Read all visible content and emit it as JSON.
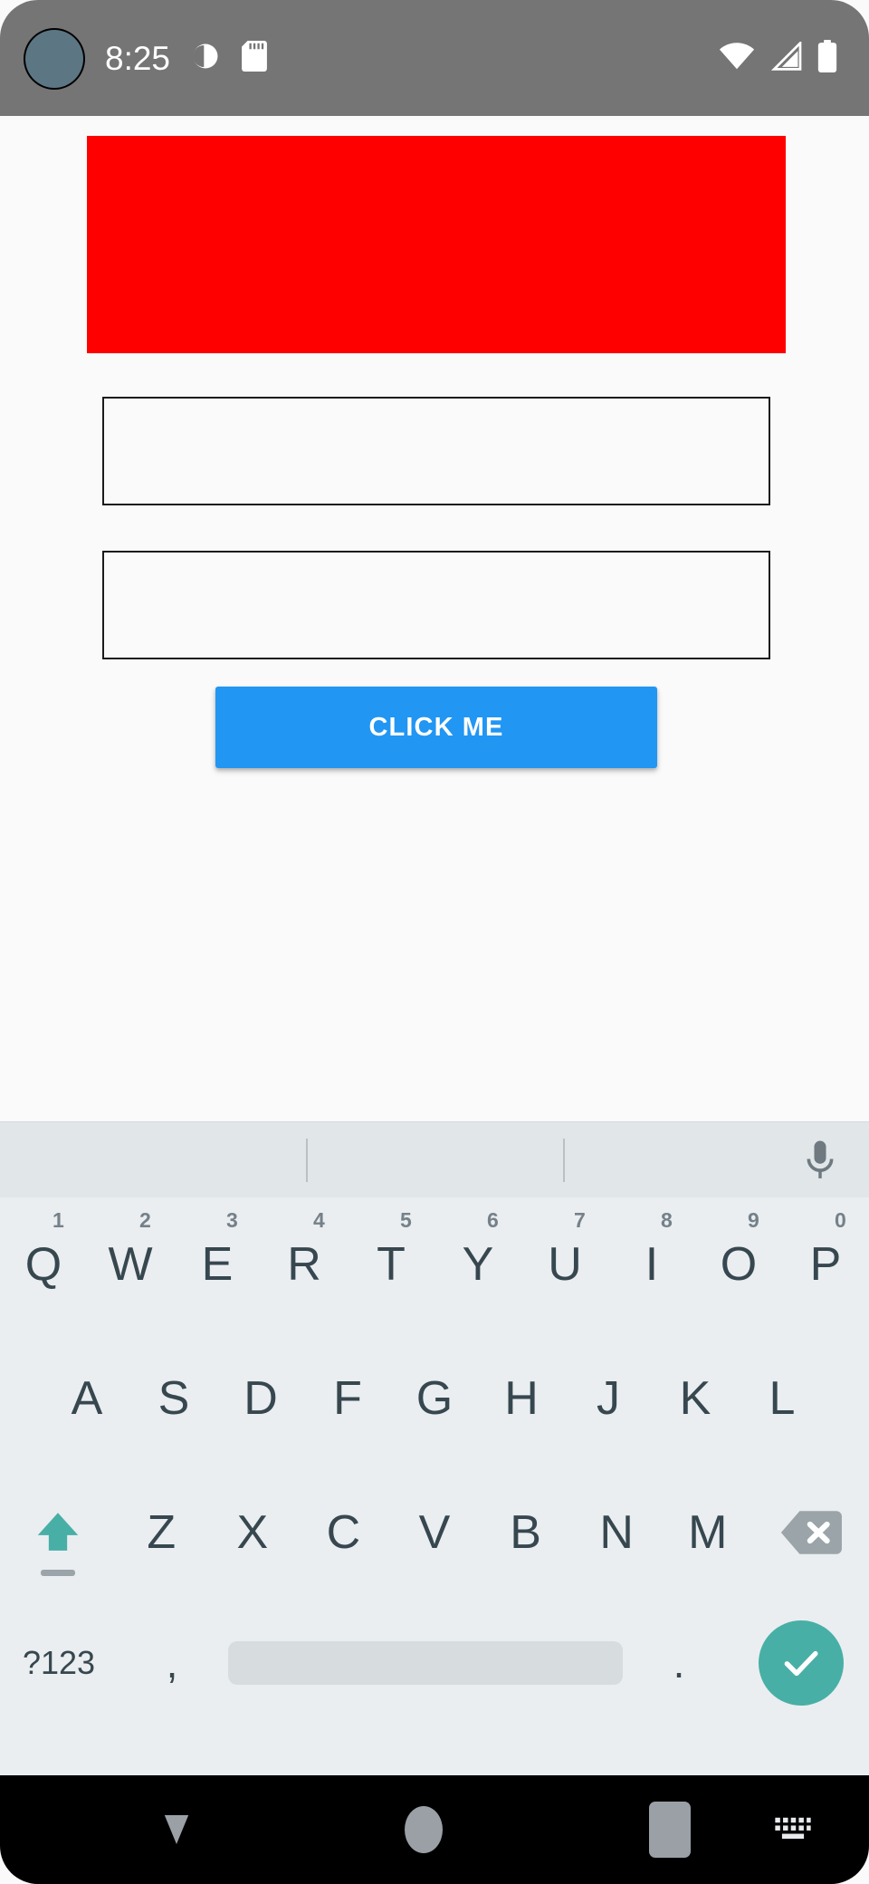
{
  "status_bar": {
    "time": "8:25",
    "background_color": "#757575",
    "icons": [
      {
        "name": "dnd-moon-icon",
        "label": "do-not-disturb"
      },
      {
        "name": "notification-dot-icon",
        "label": "notification"
      },
      {
        "name": "sd-card-icon",
        "label": "sd-card"
      },
      {
        "name": "wifi-icon",
        "label": "wifi-full"
      },
      {
        "name": "cell-signal-icon",
        "label": "cell-signal"
      },
      {
        "name": "battery-icon",
        "label": "battery-full"
      }
    ]
  },
  "app": {
    "background_color": "#FAFAFA",
    "red_banner": {
      "label": "red-image-placeholder",
      "color": "#FF0000"
    },
    "fields": [
      {
        "name": "text-field-1",
        "value": "",
        "placeholder": ""
      },
      {
        "name": "text-field-2",
        "value": "",
        "placeholder": ""
      }
    ],
    "button": {
      "label": "CLICK ME",
      "color": "#2196F3",
      "text_color": "#FFFFFF"
    }
  },
  "keyboard": {
    "background_color": "#EAEEF0",
    "key_text_color": "#37474F",
    "accent_color": "#48AFA6",
    "suggestions": [
      "",
      "",
      ""
    ],
    "mic_label": "mic-icon",
    "rows": [
      {
        "id": "row-1",
        "keys": [
          {
            "glyph": "Q",
            "hint": "1"
          },
          {
            "glyph": "W",
            "hint": "2"
          },
          {
            "glyph": "E",
            "hint": "3"
          },
          {
            "glyph": "R",
            "hint": "4"
          },
          {
            "glyph": "T",
            "hint": "5"
          },
          {
            "glyph": "Y",
            "hint": "6"
          },
          {
            "glyph": "U",
            "hint": "7"
          },
          {
            "glyph": "I",
            "hint": "8"
          },
          {
            "glyph": "O",
            "hint": "9"
          },
          {
            "glyph": "P",
            "hint": "0"
          }
        ]
      },
      {
        "id": "row-2",
        "keys": [
          {
            "glyph": "A",
            "hint": ""
          },
          {
            "glyph": "S",
            "hint": ""
          },
          {
            "glyph": "D",
            "hint": ""
          },
          {
            "glyph": "F",
            "hint": ""
          },
          {
            "glyph": "G",
            "hint": ""
          },
          {
            "glyph": "H",
            "hint": ""
          },
          {
            "glyph": "J",
            "hint": ""
          },
          {
            "glyph": "K",
            "hint": ""
          },
          {
            "glyph": "L",
            "hint": ""
          }
        ]
      },
      {
        "id": "row-3",
        "keys": [
          {
            "glyph": "Z",
            "hint": ""
          },
          {
            "glyph": "X",
            "hint": ""
          },
          {
            "glyph": "C",
            "hint": ""
          },
          {
            "glyph": "V",
            "hint": ""
          },
          {
            "glyph": "B",
            "hint": ""
          },
          {
            "glyph": "N",
            "hint": ""
          },
          {
            "glyph": "M",
            "hint": ""
          }
        ]
      }
    ],
    "shift_label": "shift-key",
    "backspace_label": "backspace-key",
    "symbols_label": "?123",
    "comma_label": ",",
    "space_label": "",
    "period_label": ".",
    "enter_label": "enter-check-icon"
  },
  "nav_bar": {
    "background_color": "#000000",
    "buttons": [
      {
        "name": "nav-back-button",
        "label": "hide-keyboard-triangle"
      },
      {
        "name": "nav-home-button",
        "label": "home-circle"
      },
      {
        "name": "nav-recents-button",
        "label": "recents-square"
      },
      {
        "name": "nav-ime-switch-button",
        "label": "keyboard-switch"
      }
    ]
  }
}
